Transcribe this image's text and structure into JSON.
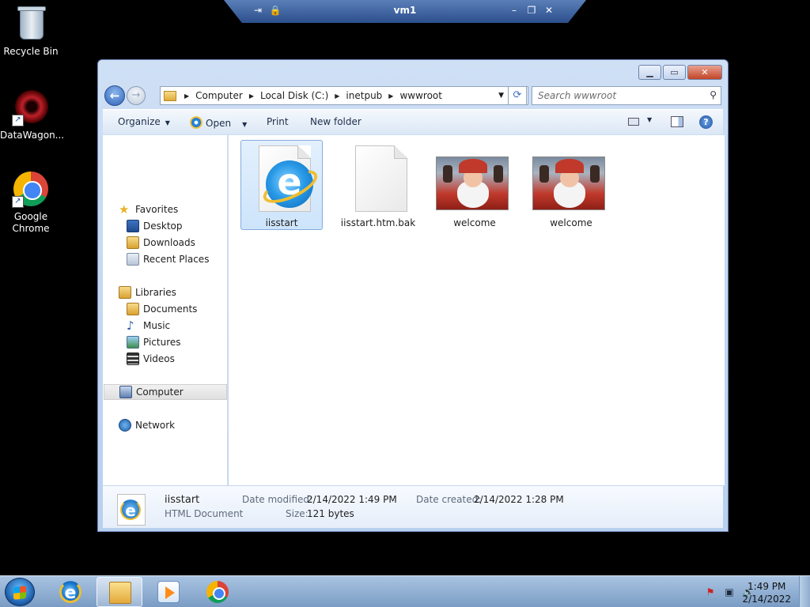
{
  "rdp": {
    "title": "vm1"
  },
  "desktop": {
    "icons": [
      {
        "label": "Recycle Bin"
      },
      {
        "label": "DataWagon..."
      },
      {
        "label": "Google Chrome"
      }
    ]
  },
  "explorer": {
    "breadcrumbs": [
      "Computer",
      "Local Disk (C:)",
      "inetpub",
      "wwwroot"
    ],
    "search_placeholder": "Search wwwroot",
    "toolbar": {
      "organize": "Organize",
      "open": "Open",
      "print": "Print",
      "new_folder": "New folder"
    },
    "nav": {
      "favorites": "Favorites",
      "desktop": "Desktop",
      "downloads": "Downloads",
      "recent_places": "Recent Places",
      "libraries": "Libraries",
      "documents": "Documents",
      "music": "Music",
      "pictures": "Pictures",
      "videos": "Videos",
      "computer": "Computer",
      "network": "Network"
    },
    "files": [
      {
        "name": "iisstart",
        "type": "ie-document",
        "selected": true
      },
      {
        "name": "iisstart.htm.bak",
        "type": "blank-document",
        "selected": false
      },
      {
        "name": "welcome",
        "type": "image",
        "selected": false
      },
      {
        "name": "welcome",
        "type": "image",
        "selected": false
      }
    ],
    "details": {
      "name": "iisstart",
      "type": "HTML Document",
      "date_modified_label": "Date modified:",
      "date_modified": "2/14/2022 1:49 PM",
      "date_created_label": "Date created:",
      "date_created": "2/14/2022 1:28 PM",
      "size_label": "Size:",
      "size": "121 bytes"
    }
  },
  "taskbar": {
    "time": "1:49 PM",
    "date": "2/14/2022"
  },
  "colors": {
    "window_frame": "#b8d0ee",
    "selection": "#cde4fb",
    "taskbar": "#7a9cc4"
  }
}
